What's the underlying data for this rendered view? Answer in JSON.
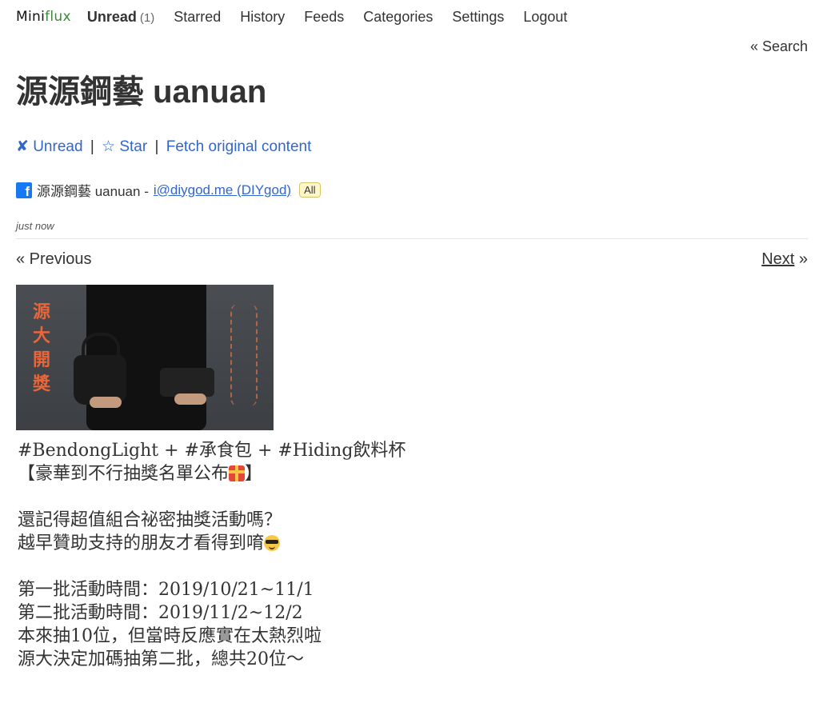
{
  "nav": {
    "logo_mini": "Mini",
    "logo_flux": "flux",
    "items": [
      {
        "label": "Unread",
        "count": "(1)"
      },
      {
        "label": "Starred"
      },
      {
        "label": "History"
      },
      {
        "label": "Feeds"
      },
      {
        "label": "Categories"
      },
      {
        "label": "Settings"
      },
      {
        "label": "Logout"
      }
    ]
  },
  "search_link": "« Search",
  "entry": {
    "title": "源源鋼藝 uanuan",
    "actions": {
      "unread_icon": "✘",
      "unread": "Unread",
      "star_icon": "☆",
      "star": "Star",
      "fetch": "Fetch original content",
      "sep": "|"
    },
    "feed_icon": "facebook-icon",
    "feed_name": "源源鋼藝 uanuan",
    "dash": "-",
    "author": "i@diygod.me (DIYgod)",
    "category": "All",
    "date": "just now",
    "prev": "« Previous",
    "next_label": "Next",
    "next_arrow": "»",
    "image_text": [
      "源",
      "大",
      "開",
      "獎"
    ],
    "content": {
      "line1": "#BendongLight + #承食包 + #Hiding飲料杯",
      "line2": "【豪華到不行抽獎名單公布",
      "line2_end": "】",
      "line3": "還記得超值組合祕密抽獎活動嗎？",
      "line4": "越早贊助支持的朋友才看得到唷",
      "line5": "第一批活動時間：2019/10/21~11/1",
      "line6": "第二批活動時間：2019/11/2~12/2",
      "line7": "本來抽10位，但當時反應實在太熱烈啦",
      "line8": "源大決定加碼抽第二批，總共20位～"
    }
  },
  "colors": {
    "link": "#3366cc",
    "logo_accent": "#3a8a3a",
    "badge_bg": "#fff7cc"
  }
}
